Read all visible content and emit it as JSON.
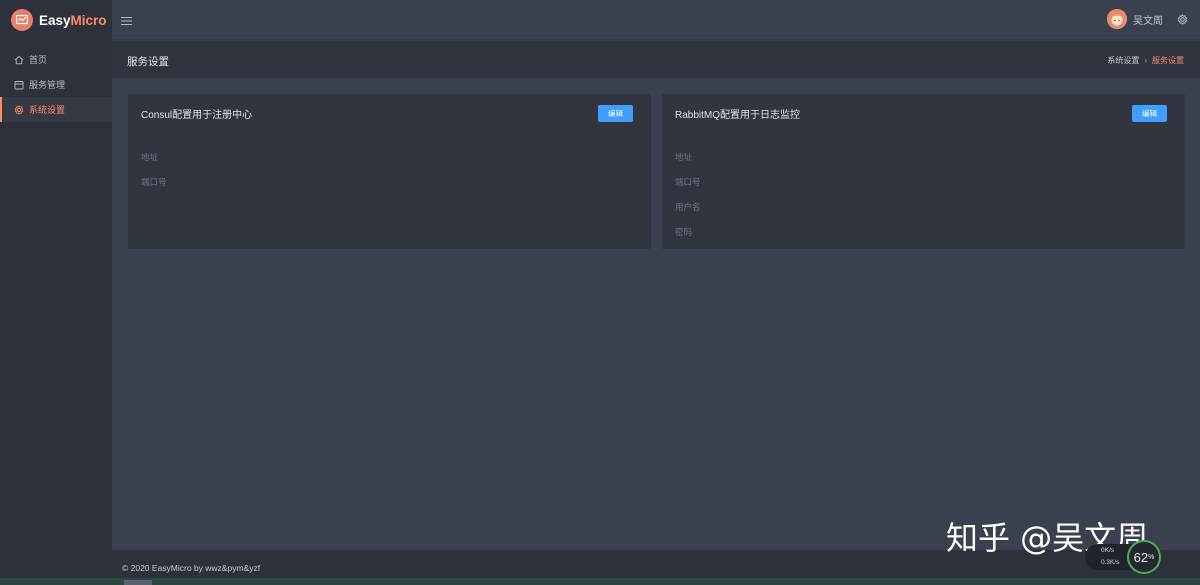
{
  "app": {
    "name_part1": "Easy",
    "name_part2": "Micro"
  },
  "sidebar": {
    "items": [
      {
        "label": "首页",
        "icon": "home-icon"
      },
      {
        "label": "服务管理",
        "icon": "box-icon"
      },
      {
        "label": "系统设置",
        "icon": "gear-icon",
        "active": true
      }
    ]
  },
  "header": {
    "username": "吴文周"
  },
  "page": {
    "title": "服务设置",
    "breadcrumb": [
      "系统设置",
      "服务设置"
    ]
  },
  "cards": [
    {
      "title": "Consul配置用于注册中心",
      "button": "编辑",
      "fields": [
        "地址",
        "端口号"
      ]
    },
    {
      "title": "RabbitMQ配置用于日志监控",
      "button": "编辑",
      "fields": [
        "地址",
        "端口号",
        "用户名",
        "密码"
      ]
    }
  ],
  "footer": {
    "copyright": "© 2020 EasyMicro by wwz&pym&yzf"
  },
  "watermark": "知乎 @吴文周",
  "widget": {
    "up": "0",
    "down": "0.3",
    "unit": "K/s",
    "percent": "62",
    "percent_unit": "%"
  },
  "colors": {
    "accent": "#ff8a66",
    "primary_button": "#409eff",
    "sidebar_bg": "#2c313b",
    "content_bg": "#3a404d",
    "card_bg": "#30353f"
  }
}
